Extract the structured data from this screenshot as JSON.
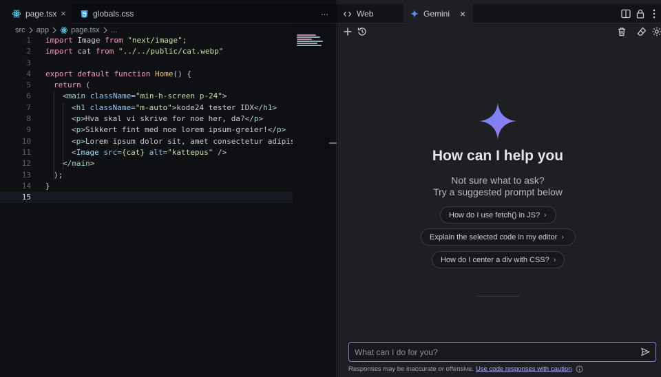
{
  "editor": {
    "tabs": [
      {
        "label": "page.tsx",
        "icon": "react-icon",
        "active": true
      },
      {
        "label": "globals.css",
        "icon": "css-icon",
        "active": false
      }
    ],
    "more_icon": "ellipsis-icon",
    "breadcrumb": [
      "src",
      "app",
      "page.tsx",
      "..."
    ],
    "current_line": 15,
    "line_numbers": [
      "1",
      "2",
      "3",
      "4",
      "5",
      "6",
      "7",
      "8",
      "9",
      "10",
      "11",
      "12",
      "13",
      "14",
      "15"
    ]
  },
  "code": {
    "l1": {
      "k1": "import",
      "t1": " Image ",
      "k2": "from",
      "t2": " ",
      "s1": "\"next/image\"",
      "t3": ";"
    },
    "l2": {
      "k1": "import",
      "t1": " cat ",
      "k2": "from",
      "t2": " ",
      "s1": "\"../../public/cat.webp\""
    },
    "l4": {
      "k1": "export default function",
      "t1": " ",
      "f1": "Home",
      "t2": "() {"
    },
    "l5": {
      "k1": "return",
      "t1": " ("
    },
    "l6": {
      "t1": "<",
      "g1": "main",
      "t2": " ",
      "a1": "className",
      "t3": "=",
      "s1": "\"min-h-screen p-24\"",
      "t4": ">"
    },
    "l7": {
      "t1": "<",
      "g1": "h1",
      "t2": " ",
      "a1": "className",
      "t3": "=",
      "s1": "\"m-auto\"",
      "t4": ">kode24 tester IDX</",
      "g2": "h1",
      "t5": ">"
    },
    "l8": {
      "t1": "<",
      "g1": "p",
      "t2": ">Hva skal vi skrive for noe her, da?</",
      "g2": "p",
      "t3": ">"
    },
    "l9": {
      "t1": "<",
      "g1": "p",
      "t2": ">Sikkert fint med noe lorem ipsum-greier!</",
      "g2": "p",
      "t3": ">"
    },
    "l10": {
      "t1": "<",
      "g1": "p",
      "t2": ">Lorem ipsum dolor sit, amet consectetur adipisic"
    },
    "l11": {
      "t1": "<",
      "c1": "Image",
      "t2": " ",
      "a1": "src",
      "t3": "=",
      "s1": "{cat}",
      "t4": " ",
      "a2": "alt",
      "t5": "=",
      "s2": "\"kattepus\"",
      "t6": " />"
    },
    "l12": {
      "t1": "</",
      "g1": "main",
      "t2": ">"
    },
    "l13": {
      "t1": ");"
    },
    "l14": {
      "t1": "}"
    }
  },
  "panel": {
    "tabs": [
      {
        "label": "Web",
        "icon": "code-brackets-icon",
        "active": false
      },
      {
        "label": "Gemini",
        "icon": "gemini-sparkle-icon",
        "active": true
      }
    ],
    "header_icons": [
      "split-editor-icon",
      "lock-icon",
      "more-vertical-icon"
    ],
    "toolbar_icons": [
      "add-icon",
      "history-icon",
      "trash-icon",
      "eraser-icon",
      "settings-icon"
    ],
    "heading": "How can I help you",
    "subheading_1": "Not sure what to ask?",
    "subheading_2": "Try a suggested prompt below",
    "suggestions": [
      "How do I use fetch() in JS?",
      "Explain the selected code in my editor",
      "How do I center a div with CSS?"
    ],
    "input_placeholder": "What can I do for you?",
    "disclaimer_text": "Responses may be inaccurate or offensive.",
    "disclaimer_link": "Use code responses with caution"
  },
  "colors": {
    "accent": "#8b7ce0",
    "link": "#aab0ff",
    "react": "#61dafb",
    "css": "#42a5f5"
  }
}
